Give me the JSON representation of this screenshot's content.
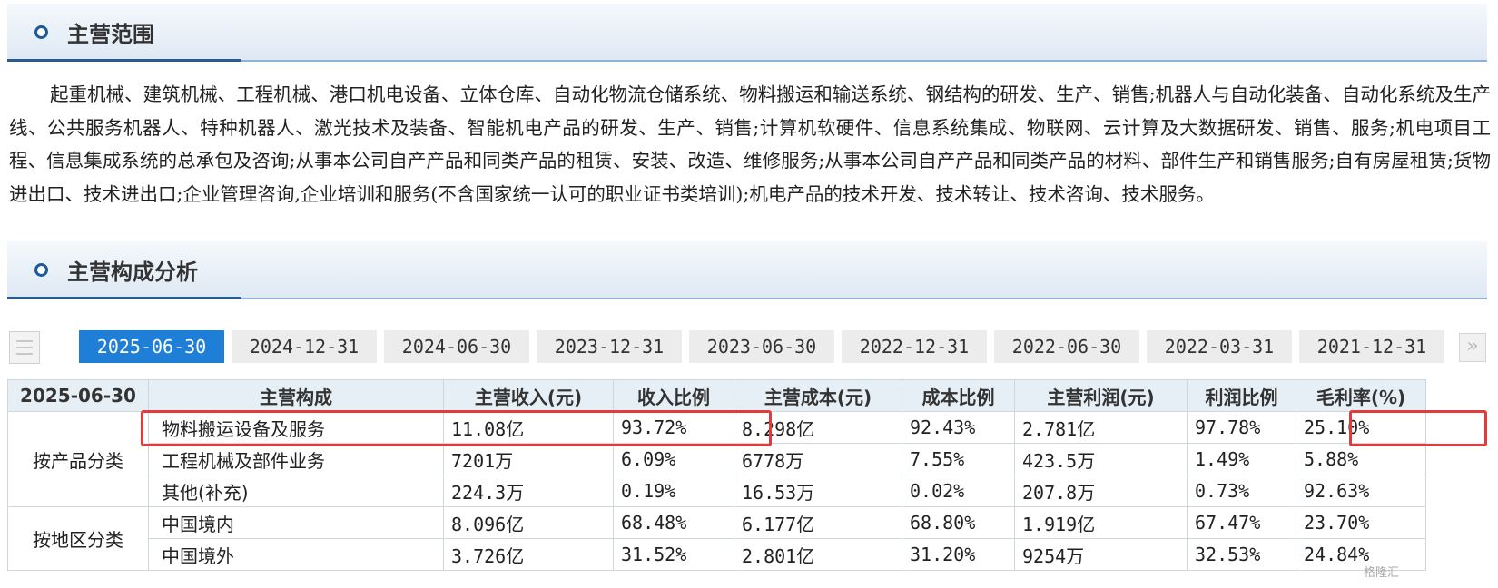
{
  "scope_section": {
    "title": "主营范围",
    "text": "起重机械、建筑机械、工程机械、港口机电设备、立体仓库、自动化物流仓储系统、物料搬运和输送系统、钢结构的研发、生产、销售;机器人与自动化装备、自动化系统及生产线、公共服务机器人、特种机器人、激光技术及装备、智能机电产品的研发、生产、销售;计算机软硬件、信息系统集成、物联网、云计算及大数据研发、销售、服务;机电项目工程、信息集成系统的总承包及咨询;从事本公司自产产品和同类产品的租赁、安装、改造、维修服务;从事本公司自产产品和同类产品的材料、部件生产和销售服务;自有房屋租赁;货物进出口、技术进出口;企业管理咨询,企业培训和服务(不含国家统一认可的职业证书类培训);机电产品的技术开发、技术转让、技术咨询、技术服务。"
  },
  "composition_section": {
    "title": "主营构成分析",
    "tabs": [
      "2025-06-30",
      "2024-12-31",
      "2024-06-30",
      "2023-12-31",
      "2023-06-30",
      "2022-12-31",
      "2022-06-30",
      "2022-03-31",
      "2021-12-31"
    ],
    "active_tab": 0,
    "table": {
      "headers": [
        "2025-06-30",
        "主营构成",
        "主营收入(元)",
        "收入比例",
        "主营成本(元)",
        "成本比例",
        "主营利润(元)",
        "利润比例",
        "毛利率(%)"
      ],
      "groups": [
        {
          "category": "按产品分类",
          "rows": [
            [
              "物料搬运设备及服务",
              "11.08亿",
              "93.72%",
              "8.298亿",
              "92.43%",
              "2.781亿",
              "97.78%",
              "25.10%"
            ],
            [
              "工程机械及部件业务",
              "7201万",
              "6.09%",
              "6778万",
              "7.55%",
              "423.5万",
              "1.49%",
              "5.88%"
            ],
            [
              "其他(补充)",
              "224.3万",
              "0.19%",
              "16.53万",
              "0.02%",
              "207.8万",
              "0.73%",
              "92.63%"
            ]
          ]
        },
        {
          "category": "按地区分类",
          "rows": [
            [
              "中国境内",
              "8.096亿",
              "68.48%",
              "6.177亿",
              "68.80%",
              "1.919亿",
              "67.47%",
              "23.70%"
            ],
            [
              "中国境外",
              "3.726亿",
              "31.52%",
              "2.801亿",
              "31.20%",
              "9254万",
              "32.53%",
              "24.84%"
            ]
          ]
        }
      ]
    }
  },
  "watermark": "格隆汇",
  "colors": {
    "accent": "#1f7fd6",
    "highlight": "#e23b3b",
    "header_bg": "#e6eef6"
  }
}
